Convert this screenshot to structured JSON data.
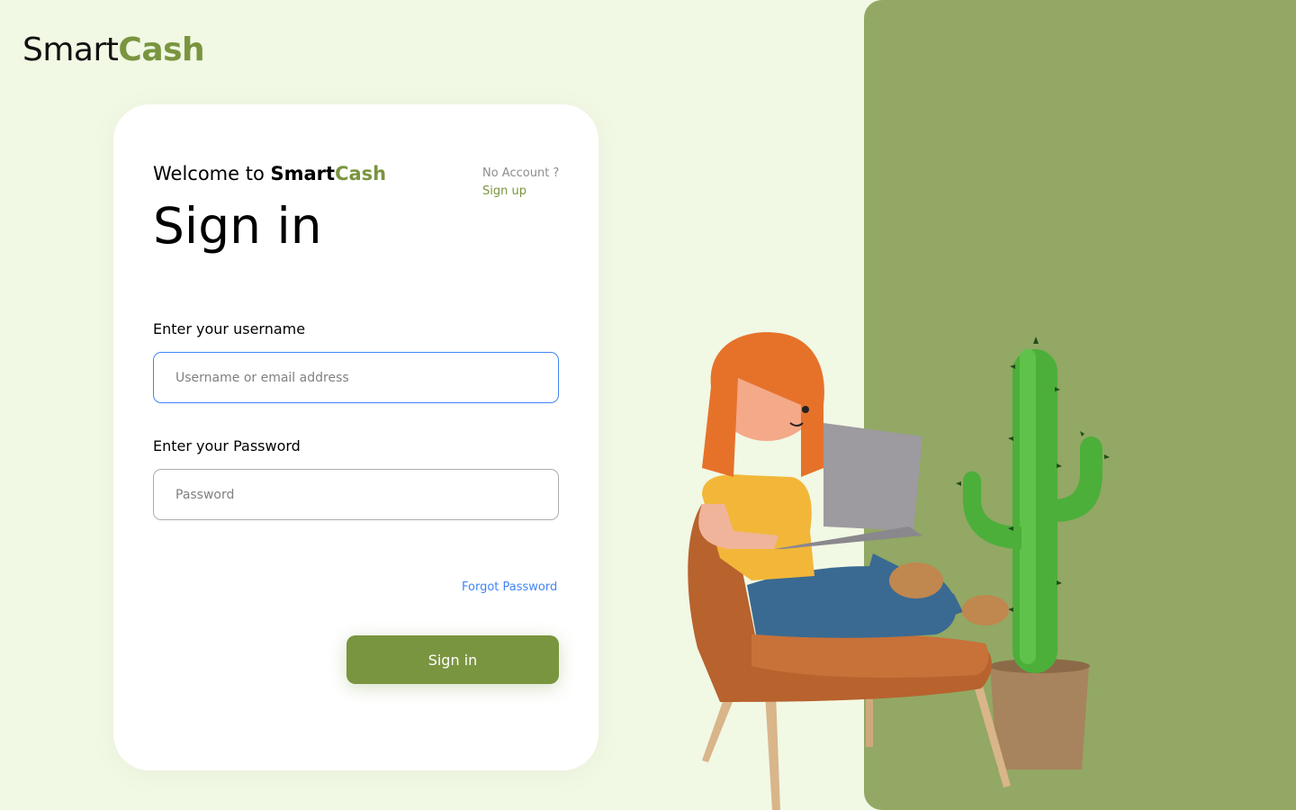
{
  "brand": {
    "name_dark": "Smart",
    "name_accent": "Cash"
  },
  "card": {
    "welcome_prefix": "Welcome to ",
    "brand_dark": "Smart",
    "brand_accent": "Cash",
    "title": "Sign in",
    "no_account": "No Account ?",
    "signup_link": "Sign up"
  },
  "form": {
    "username_label": "Enter your username",
    "username_placeholder": "Username or email address",
    "password_label": "Enter your Password",
    "password_placeholder": "Password",
    "forgot_password": "Forgot Password",
    "submit_label": "Sign in"
  },
  "colors": {
    "background": "#f1f8e4",
    "accent": "#7a953f",
    "panel": "#92a864",
    "link_blue": "#4285f4"
  },
  "illustration": {
    "icons": [
      "woman-with-laptop-illustration",
      "armchair-illustration",
      "cactus-plant-illustration"
    ]
  }
}
